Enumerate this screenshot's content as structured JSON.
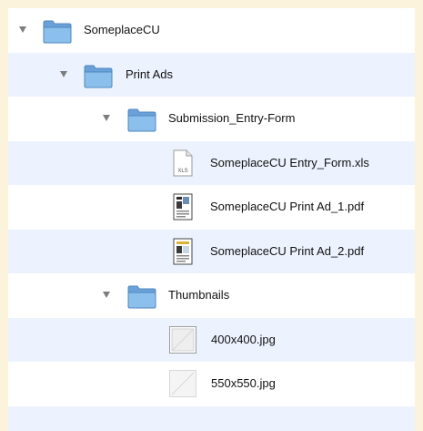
{
  "tree": {
    "root_folder": {
      "label": "SomeplaceCU",
      "icon": "folder-icon",
      "expanded": true
    },
    "print_ads_folder": {
      "label": "Print Ads",
      "icon": "folder-icon",
      "expanded": true
    },
    "submission_folder": {
      "label": "Submission_Entry-Form",
      "icon": "folder-icon",
      "expanded": true
    },
    "files_submission": [
      {
        "label": "SomeplaceCU Entry_Form.xls",
        "icon": "xls-file-icon",
        "badge": "XLS"
      },
      {
        "label": "SomeplaceCU Print Ad_1.pdf",
        "icon": "pdf-file-icon"
      },
      {
        "label": "SomeplaceCU Print Ad_2.pdf",
        "icon": "pdf-file-icon"
      }
    ],
    "thumbnails_folder": {
      "label": "Thumbnails",
      "icon": "folder-icon",
      "expanded": true
    },
    "files_thumbnails": [
      {
        "label": "400x400.jpg",
        "icon": "jpg-thumbnail-icon"
      },
      {
        "label": "550x550.jpg",
        "icon": "jpg-thumbnail-icon"
      }
    ]
  },
  "colors": {
    "background": "#fbf3dc",
    "row_alt": "#edf3fe",
    "folder_blue": "#7fb2e4"
  }
}
